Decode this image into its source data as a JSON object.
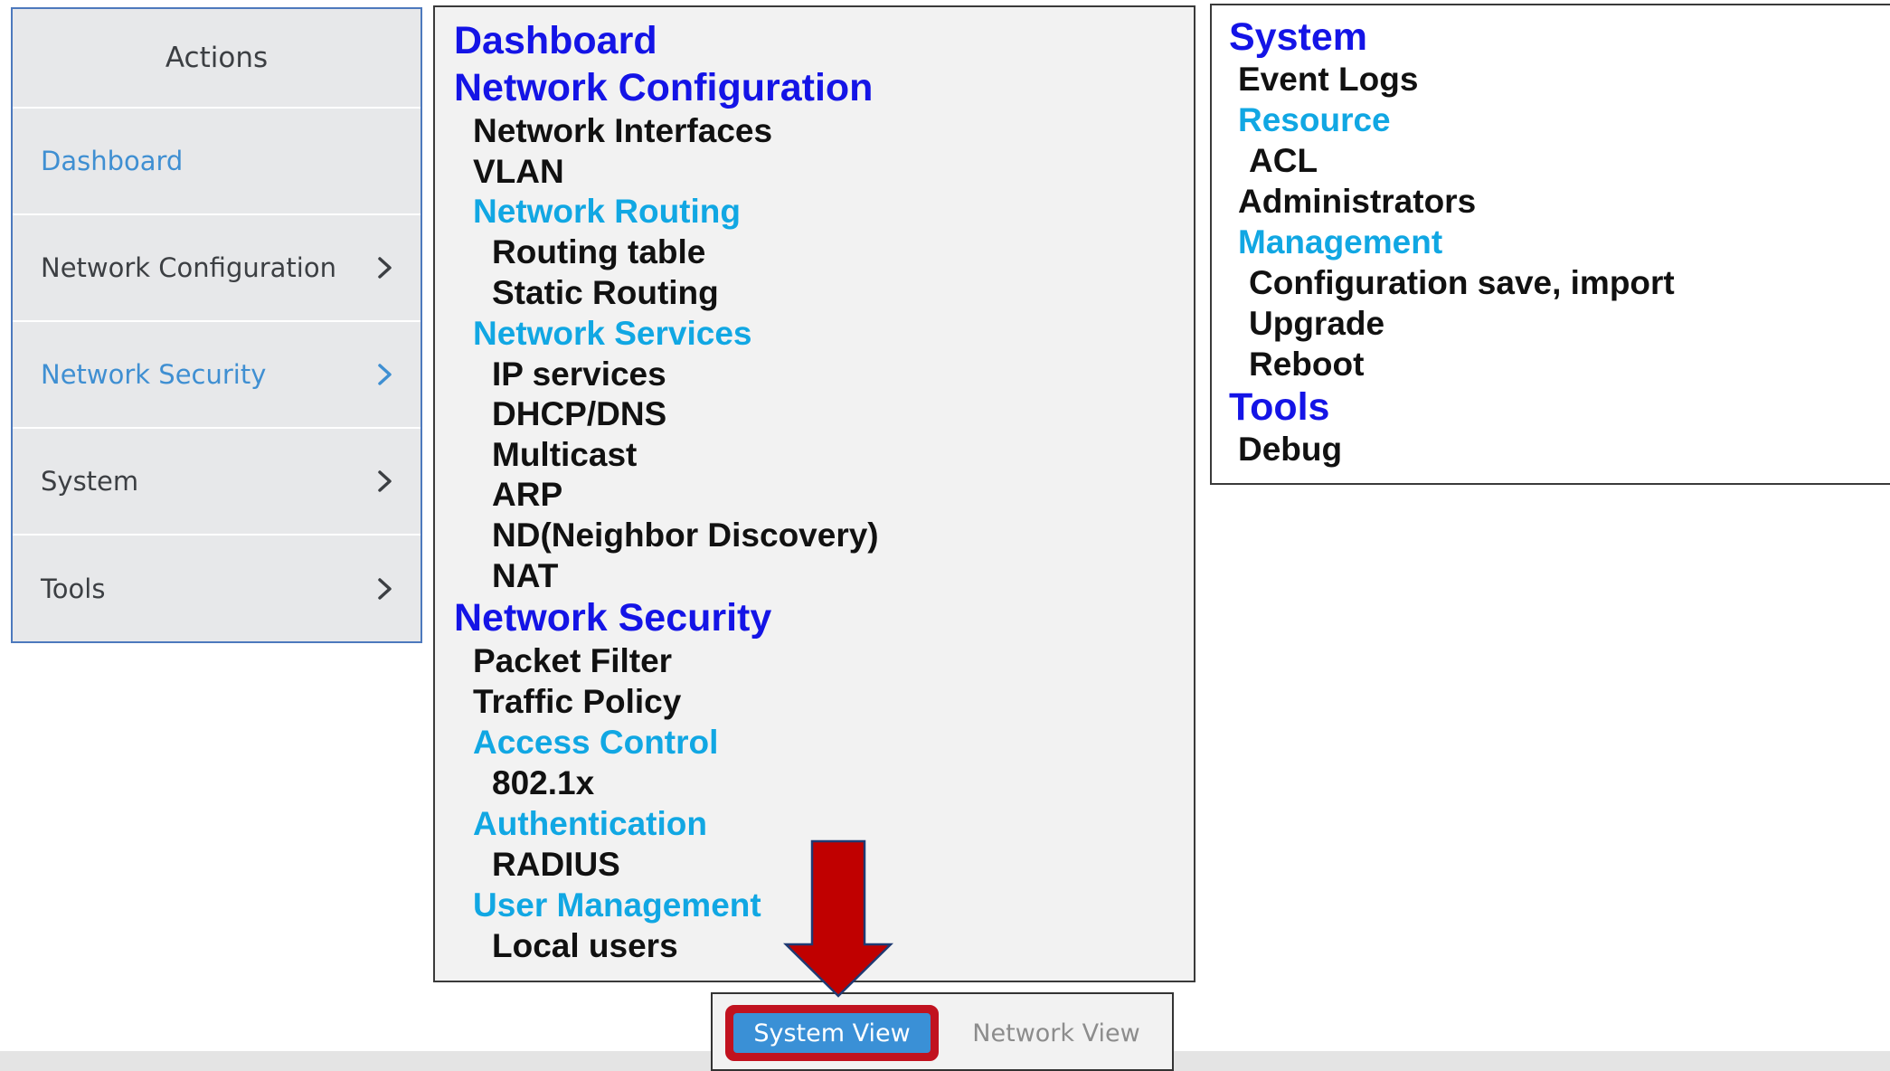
{
  "actions": {
    "header": "Actions",
    "items": [
      {
        "label": "Dashboard",
        "chevron": false,
        "color": "#3f8fd2"
      },
      {
        "label": "Network Configuration",
        "chevron": true,
        "color": "#3c3f43"
      },
      {
        "label": "Network Security",
        "chevron": true,
        "color": "#3f8fd2"
      },
      {
        "label": "System",
        "chevron": true,
        "color": "#3c3f43"
      },
      {
        "label": "Tools",
        "chevron": true,
        "color": "#3c3f43"
      }
    ]
  },
  "menu_tree_left": [
    "Dashboard",
    "Network Configuration",
    "Network Interfaces",
    "VLAN",
    "Network Routing",
    "Routing table",
    "Static Routing",
    "Network Services",
    "IP services",
    "DHCP/DNS",
    "Multicast",
    "ARP",
    "ND(Neighbor Discovery)",
    "NAT",
    "Network Security",
    "Packet Filter",
    "Traffic Policy",
    "Access Control",
    "802.1x",
    "Authentication",
    "RADIUS",
    "User Management",
    "Local users"
  ],
  "menu_tree_right": [
    "System",
    "Event Logs",
    "Resource",
    "ACL",
    "Administrators",
    "Management",
    "Configuration save, import",
    "Upgrade",
    "Reboot",
    "Tools",
    "Debug"
  ],
  "view_switcher": {
    "system_view": "System View",
    "network_view": "Network View"
  },
  "colors": {
    "level1": "#1414e6",
    "level2": "#11a7e3",
    "level3": "#111111",
    "highlight": "#c1121f",
    "button_blue": "#3a90d6"
  },
  "icons": {
    "chevron": "chevron-right-icon",
    "arrow": "arrow-down-icon"
  }
}
